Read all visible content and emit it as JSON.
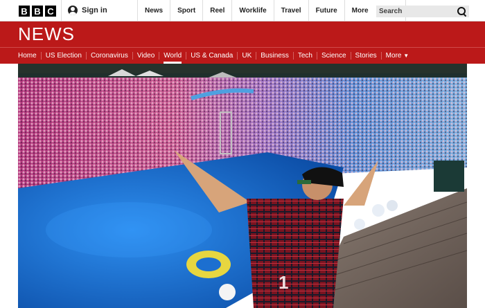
{
  "brand": {
    "letters": [
      "B",
      "B",
      "C"
    ]
  },
  "header": {
    "signin": "Sign in",
    "nav": [
      "News",
      "Sport",
      "Reel",
      "Worklife",
      "Travel",
      "Future"
    ],
    "more": "More",
    "search_placeholder": "Search"
  },
  "news": {
    "title": "NEWS",
    "subnav": [
      "Home",
      "US Election",
      "Coronavirus",
      "Video",
      "World",
      "US & Canada",
      "UK",
      "Business",
      "Tech",
      "Science",
      "Stories"
    ],
    "active": "World",
    "more": "More"
  },
  "hero": {
    "shirt_text": "1"
  },
  "colors": {
    "brand_red": "#bb1919",
    "pool_blue": "#1c6fd0"
  }
}
